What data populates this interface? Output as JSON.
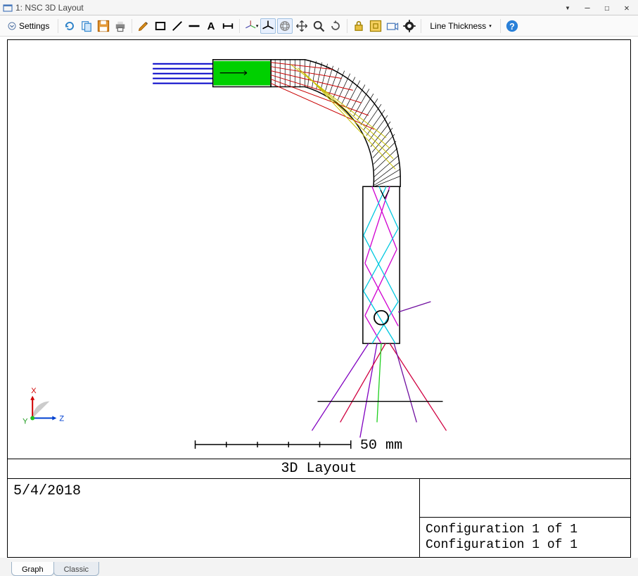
{
  "window": {
    "title": "1: NSC 3D Layout"
  },
  "toolbar": {
    "settings": "Settings",
    "line_thickness": "Line Thickness"
  },
  "viewport": {
    "title": "3D Layout",
    "date": "5/4/2018",
    "scale_label": "50 mm",
    "axes": {
      "x": "X",
      "y": "Y",
      "z": "Z"
    },
    "config_line1": "Configuration 1 of 1",
    "config_line2": "Configuration 1 of 1"
  },
  "tabs": {
    "graph": "Graph",
    "classic": "Classic"
  }
}
